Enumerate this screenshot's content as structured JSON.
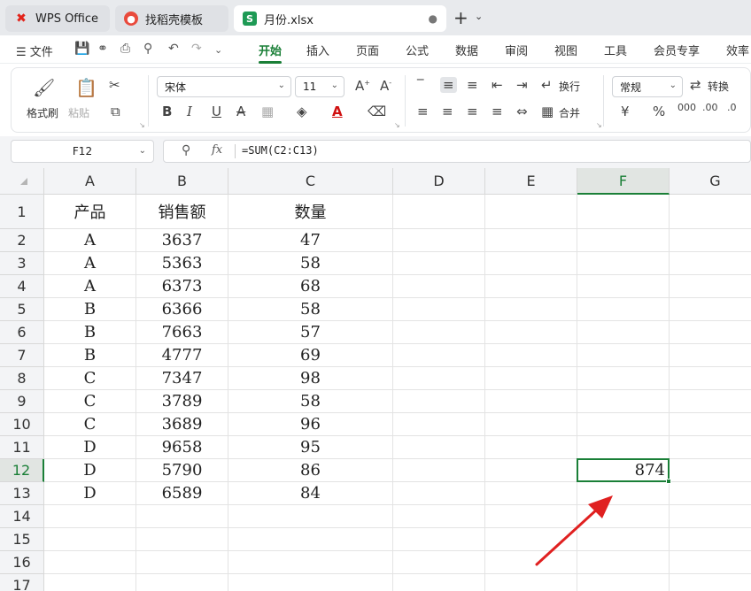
{
  "tabs": [
    {
      "label": "WPS Office",
      "icon": "wps-logo-icon"
    },
    {
      "label": "找稻壳模板",
      "icon": "daoke-icon"
    },
    {
      "label": "月份.xlsx",
      "icon": "spreadsheet-s-icon",
      "badge": "S"
    }
  ],
  "menubar": {
    "file_label": "文件",
    "tabs": [
      "开始",
      "插入",
      "页面",
      "公式",
      "数据",
      "审阅",
      "视图",
      "工具",
      "会员专享",
      "效率"
    ],
    "active_tab": "开始"
  },
  "ribbon": {
    "format_painter": "格式刷",
    "paste": "粘贴",
    "font_name": "宋体",
    "font_size": "11",
    "wrap_text": "换行",
    "merge": "合并",
    "number_format": "常规",
    "convert": "转换"
  },
  "formula_bar": {
    "name_box": "F12",
    "fx_label": "fx",
    "formula": "=SUM(C2:C13)"
  },
  "sheet": {
    "columns": [
      "A",
      "B",
      "C",
      "D",
      "E",
      "F",
      "G"
    ],
    "rows": [
      "1",
      "2",
      "3",
      "4",
      "5",
      "6",
      "7",
      "8",
      "9",
      "10",
      "11",
      "12",
      "13",
      "14",
      "15",
      "16",
      "17"
    ],
    "selected_cell": "F12",
    "selected_column": "F",
    "selected_row": "12",
    "cells": [
      [
        "产品",
        "销售额",
        "数量"
      ],
      [
        "A",
        "3637",
        "47"
      ],
      [
        "A",
        "5363",
        "58"
      ],
      [
        "A",
        "6373",
        "68"
      ],
      [
        "B",
        "6366",
        "58"
      ],
      [
        "B",
        "7663",
        "57"
      ],
      [
        "B",
        "4777",
        "69"
      ],
      [
        "C",
        "7347",
        "98"
      ],
      [
        "C",
        "3789",
        "58"
      ],
      [
        "C",
        "3689",
        "96"
      ],
      [
        "D",
        "9658",
        "95"
      ],
      [
        "D",
        "5790",
        "86"
      ],
      [
        "D",
        "6589",
        "84"
      ]
    ],
    "f12_value": "874"
  },
  "colors": {
    "accent": "#1a7f37",
    "arrow": "#e02020"
  }
}
